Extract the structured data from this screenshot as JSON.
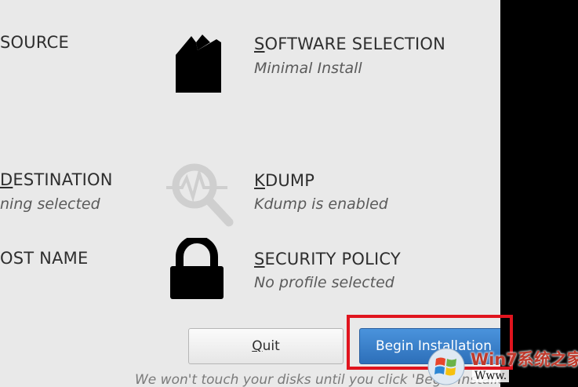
{
  "spokes": {
    "installation_source": {
      "title": "SOURCE",
      "status": ""
    },
    "software_selection": {
      "title_mnemonic": "S",
      "title_rest": "OFTWARE SELECTION",
      "status": "Minimal Install"
    },
    "installation_destination": {
      "title_mnemonic": "D",
      "title_rest": "ESTINATION",
      "status": "ning selected"
    },
    "kdump": {
      "title_mnemonic": "K",
      "title_rest": "DUMP",
      "status": "Kdump is enabled"
    },
    "network_hostname": {
      "title": "OST NAME",
      "status": ""
    },
    "security_policy": {
      "title_mnemonic": "S",
      "title_rest": "ECURITY POLICY",
      "status": "No profile selected"
    }
  },
  "buttons": {
    "quit_mnemonic": "Q",
    "quit_rest": "uit",
    "begin_label": "Begin Installation"
  },
  "footer": {
    "note": "We won't touch your disks until you click 'Begin Installatio"
  },
  "watermark": {
    "text": "Win7系统之家",
    "url": "Www."
  },
  "colors": {
    "panel_bg": "#e9e9e9",
    "accent_blue": "#3a80cc",
    "highlight_red": "#e0141e"
  },
  "icons": {
    "software_selection": "package-icon",
    "kdump": "magnifier-pulse-icon",
    "security_policy": "padlock-icon"
  }
}
